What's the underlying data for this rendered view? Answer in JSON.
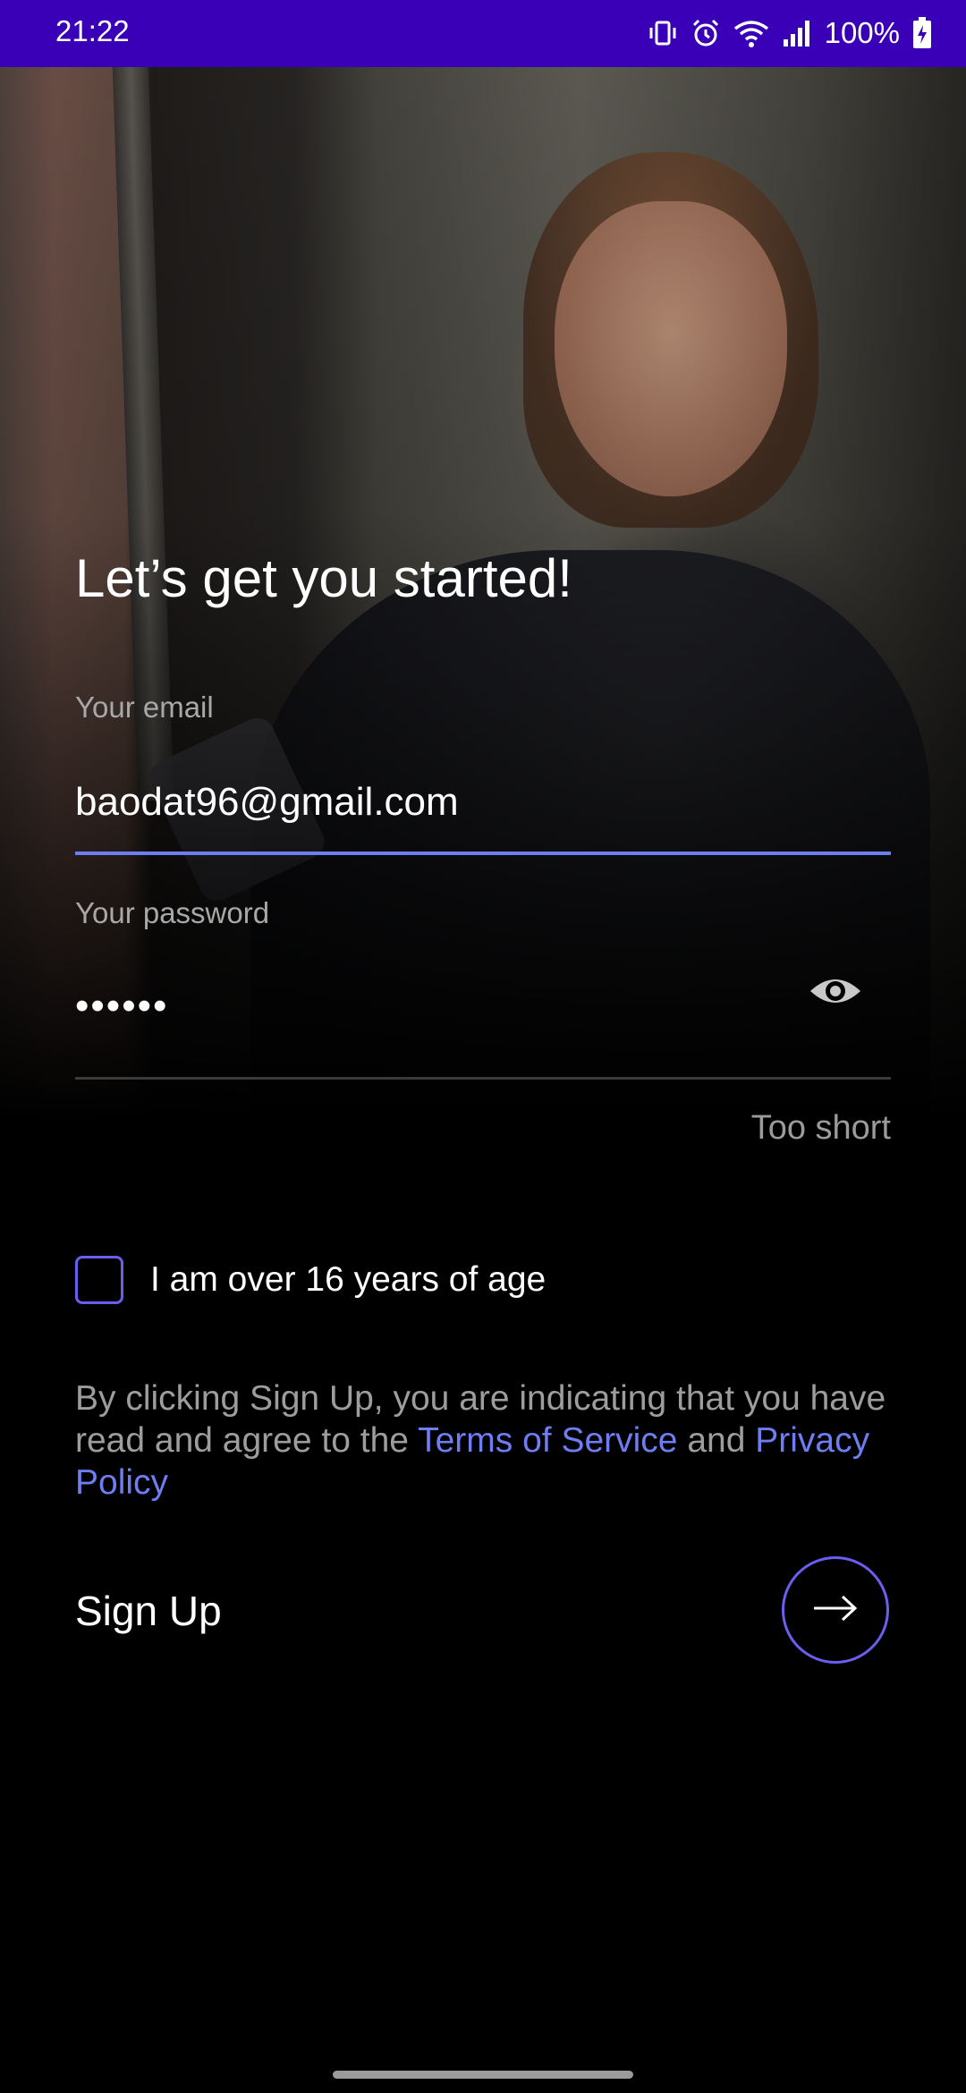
{
  "status_bar": {
    "time": "21:22",
    "battery_percent": "100%",
    "background_color": "#3a00b8",
    "icons": [
      "vibrate-icon",
      "alarm-icon",
      "wifi-icon",
      "cell-signal-icon",
      "battery-charging-icon"
    ]
  },
  "signup": {
    "title": "Let’s get you started!",
    "email": {
      "label": "Your email",
      "value": "baodat96@gmail.com"
    },
    "password": {
      "label": "Your password",
      "masked_value": "••••••",
      "helper_text": "Too short",
      "visibility_icon": "eye-icon"
    },
    "age_checkbox": {
      "label": "I am over 16 years of age",
      "checked": false
    },
    "terms": {
      "prefix": "By clicking Sign Up, you are indicating that you have read and agree to the ",
      "terms_link": "Terms of Service",
      "middle": " and ",
      "privacy_link": "Privacy Policy"
    },
    "submit": {
      "label": "Sign Up",
      "icon": "arrow-right-icon"
    }
  },
  "colors": {
    "accent": "#6f7df2",
    "checkbox_border": "#6a5ef0",
    "background": "#000000"
  }
}
